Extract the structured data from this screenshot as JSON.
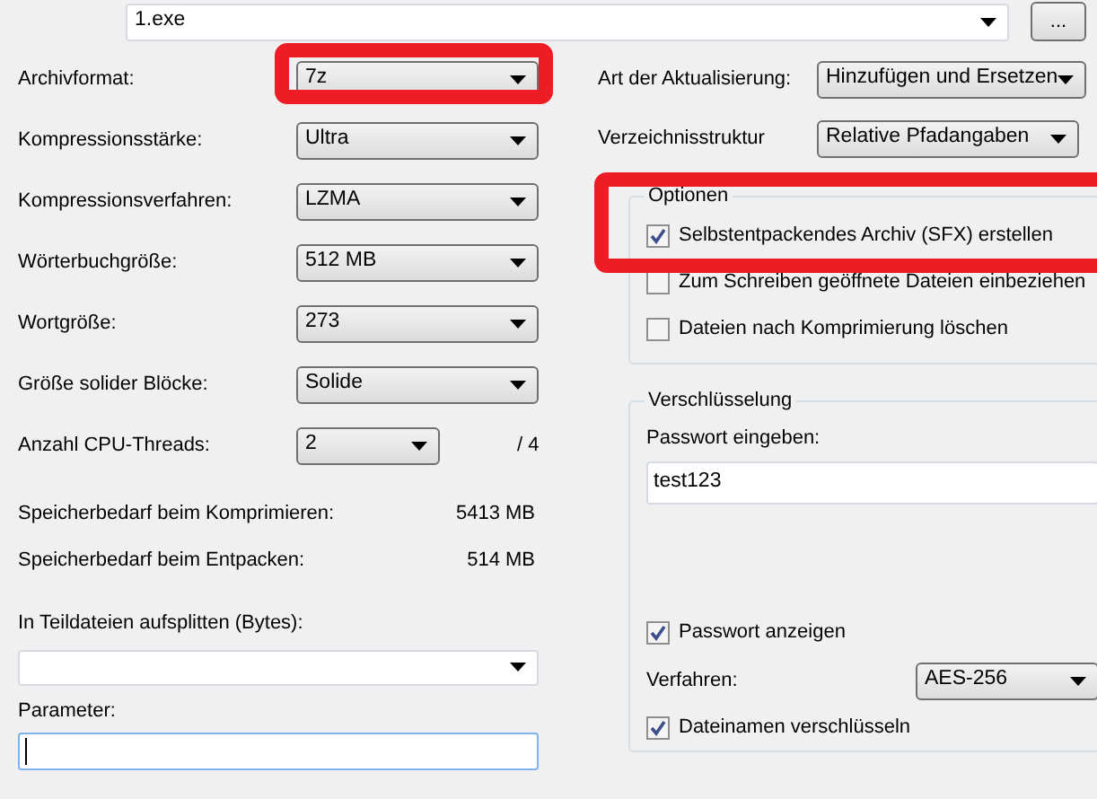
{
  "archive": {
    "value": "1.exe",
    "browse_label": "..."
  },
  "left_fields": [
    {
      "kind": "combo",
      "label": "Archivformat:",
      "value": "7z",
      "highlighted": true
    },
    {
      "kind": "combo",
      "label": "Kompressionsstärke:",
      "value": "Ultra",
      "highlighted": false
    },
    {
      "kind": "combo",
      "label": "Kompressionsverfahren:",
      "value": "LZMA",
      "highlighted": false
    },
    {
      "kind": "combo",
      "label": "Wörterbuchgröße:",
      "value": "512 MB",
      "highlighted": false
    },
    {
      "kind": "combo",
      "label": "Wortgröße:",
      "value": "273",
      "highlighted": false
    },
    {
      "kind": "combo",
      "label": "Größe solider Blöcke:",
      "value": "Solide",
      "highlighted": false
    },
    {
      "kind": "narrow",
      "label": "Anzahl CPU-Threads:",
      "value": "2",
      "suffix": "/ 4",
      "highlighted": false
    }
  ],
  "memory": [
    {
      "label": "Speicherbedarf beim Komprimieren:",
      "value": "5413 MB"
    },
    {
      "label": "Speicherbedarf beim Entpacken:",
      "value": "514 MB"
    }
  ],
  "split": {
    "label": "In Teildateien aufsplitten (Bytes):"
  },
  "parameters": {
    "label": "Parameter:",
    "focused": true
  },
  "right_fields": [
    {
      "label": "Art der Aktualisierung:",
      "value": "Hinzufügen und Ersetzen"
    },
    {
      "label": "Verzeichnisstruktur",
      "value": "Relative Pfadangaben"
    }
  ],
  "options": {
    "title": "Optionen",
    "highlighted": true,
    "items": [
      {
        "label": "Selbstentpackendes Archiv (SFX) erstellen",
        "checked": true
      },
      {
        "label": "Zum Schreiben geöffnete Dateien einbeziehen",
        "checked": false
      },
      {
        "label": "Dateien nach Komprimierung löschen",
        "checked": false
      }
    ]
  },
  "encryption": {
    "title": "Verschlüsselung",
    "password_label": "Passwort eingeben:",
    "password": "test123",
    "show_password": {
      "label": "Passwort anzeigen",
      "checked": true
    },
    "method_label": "Verfahren:",
    "method": "AES-256",
    "encrypt_names": {
      "label": "Dateinamen verschlüsseln",
      "checked": true
    }
  }
}
